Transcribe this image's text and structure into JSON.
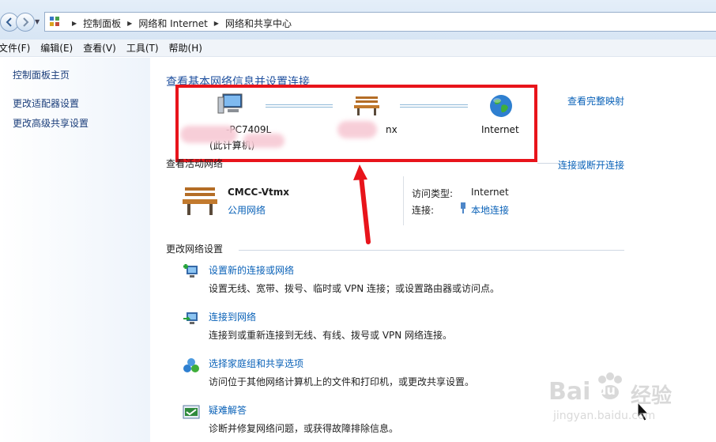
{
  "breadcrumb": [
    "控制面板",
    "网络和 Internet",
    "网络和共享中心"
  ],
  "menu": [
    "文件(F)",
    "编辑(E)",
    "查看(V)",
    "工具(T)",
    "帮助(H)"
  ],
  "sidebar": {
    "items": [
      "控制面板主页",
      "更改适配器设置",
      "更改高级共享设置"
    ]
  },
  "main": {
    "title": "查看基本网络信息并设置连接",
    "full_map": "查看完整映射",
    "map": {
      "computer_name_tail": "-PC7409L",
      "computer_sub": "(此计算机)",
      "network_tail": "nx",
      "internet": "Internet"
    },
    "active": {
      "heading": "查看活动网络",
      "connect_disconnect": "连接或断开连接",
      "network_name": "CMCC-Vtmx",
      "network_type": "公用网络",
      "access_label": "访问类型:",
      "access_value": "Internet",
      "conn_label": "连接:",
      "conn_value": "本地连接"
    },
    "change": {
      "heading": "更改网络设置",
      "tasks": [
        {
          "title": "设置新的连接或网络",
          "desc": "设置无线、宽带、拨号、临时或 VPN 连接；或设置路由器或访问点。"
        },
        {
          "title": "连接到网络",
          "desc": "连接到或重新连接到无线、有线、拨号或 VPN 网络连接。"
        },
        {
          "title": "选择家庭组和共享选项",
          "desc": "访问位于其他网络计算机上的文件和打印机，或更改共享设置。"
        },
        {
          "title": "疑难解答",
          "desc": "诊断并修复网络问题，或获得故障排除信息。"
        }
      ]
    }
  },
  "watermark": {
    "brand": "Bai",
    "brand_tail": "du",
    "jingyan": "经验",
    "url": "jingyan.baidu.com"
  },
  "colors": {
    "highlight": "#e8141b",
    "link": "#0a62b8"
  }
}
